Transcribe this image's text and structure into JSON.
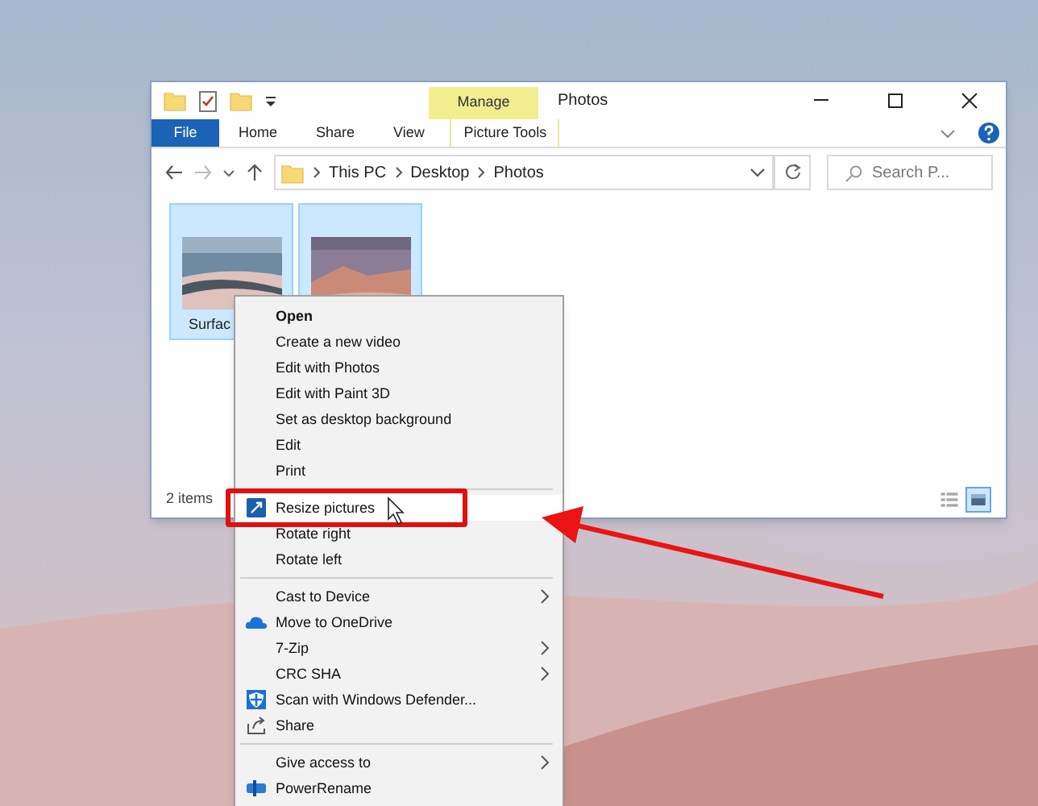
{
  "window": {
    "title": "Photos",
    "contextual_group": "Manage"
  },
  "ribbon": {
    "tabs": [
      {
        "label": "File",
        "kind": "file"
      },
      {
        "label": "Home",
        "kind": "plain"
      },
      {
        "label": "Share",
        "kind": "plain"
      },
      {
        "label": "View",
        "kind": "plain"
      },
      {
        "label": "Picture Tools",
        "kind": "contextual"
      }
    ]
  },
  "address_bar": {
    "crumbs": [
      "This PC",
      "Desktop",
      "Photos"
    ]
  },
  "search": {
    "placeholder": "Search P..."
  },
  "files": [
    {
      "label": "Surfac",
      "selected": true
    },
    {
      "selected": true
    }
  ],
  "status_bar": {
    "text": "2 items"
  },
  "view_buttons": [
    {
      "kind": "details",
      "selected": false
    },
    {
      "kind": "large-icons",
      "selected": true
    }
  ],
  "context_menu": {
    "groups": [
      [
        {
          "label": "Open",
          "kind": "plain",
          "default": true
        },
        {
          "label": "Create a new video",
          "kind": "plain"
        },
        {
          "label": "Edit with Photos",
          "kind": "plain"
        },
        {
          "label": "Edit with Paint 3D",
          "kind": "plain"
        },
        {
          "label": "Set as desktop background",
          "kind": "plain"
        },
        {
          "label": "Edit",
          "kind": "plain"
        },
        {
          "label": "Print",
          "kind": "plain"
        }
      ],
      [
        {
          "label": "Resize pictures",
          "kind": "resize",
          "selected": true
        },
        {
          "label": "Rotate right",
          "kind": "plain"
        },
        {
          "label": "Rotate left",
          "kind": "plain"
        }
      ],
      [
        {
          "label": "Cast to Device",
          "kind": "plain",
          "submenu": true
        },
        {
          "label": "Move to OneDrive",
          "kind": "onedrive"
        },
        {
          "label": "7-Zip",
          "kind": "plain",
          "submenu": true
        },
        {
          "label": "CRC SHA",
          "kind": "plain",
          "submenu": true
        },
        {
          "label": "Scan with Windows Defender...",
          "kind": "defender"
        },
        {
          "label": "Share",
          "kind": "share"
        }
      ],
      [
        {
          "label": "Give access to",
          "kind": "plain",
          "submenu": true
        },
        {
          "label": "PowerRename",
          "kind": "powerrename"
        }
      ]
    ]
  }
}
